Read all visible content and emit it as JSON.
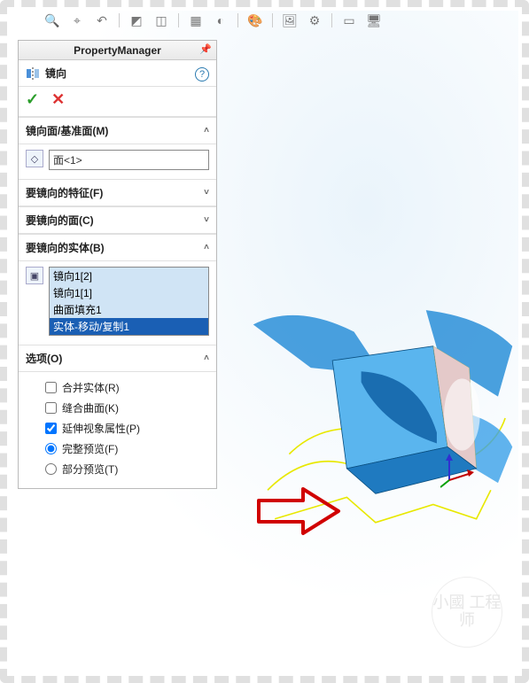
{
  "panel_title": "PropertyManager",
  "feature": {
    "name": "镜向",
    "help": "?"
  },
  "okcancel": {
    "ok": "✓",
    "cancel": "✕"
  },
  "sections": {
    "mirror_face": {
      "title": "镜向面/基准面(M)",
      "value": "面<1>"
    },
    "features": {
      "title": "要镜向的特征(F)"
    },
    "faces": {
      "title": "要镜向的面(C)"
    },
    "bodies": {
      "title": "要镜向的实体(B)",
      "items": [
        "镜向1[2]",
        "镜向1[1]",
        "曲面填充1",
        "实体-移动/复制1"
      ],
      "selected_index": 3
    },
    "options": {
      "title": "选项(O)",
      "merge": "合并实体(R)",
      "knit": "缝合曲面(K)",
      "propagate": "延伸视象属性(P)",
      "full_preview": "完整预览(F)",
      "partial_preview": "部分预览(T)"
    }
  },
  "watermark": "小國\n工程师",
  "chevrons": {
    "expanded": "˄",
    "collapsed": "˅"
  }
}
